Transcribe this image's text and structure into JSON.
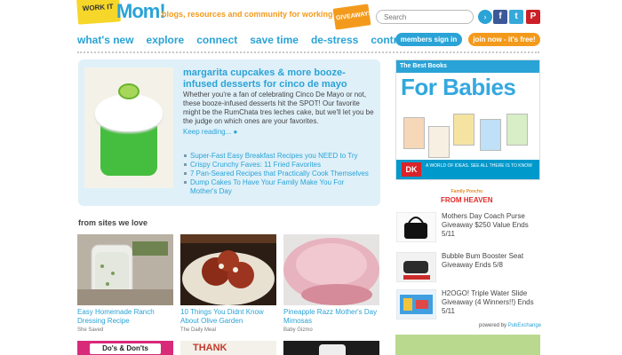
{
  "header": {
    "logo_note": "WORK IT",
    "logo_word": "Mom!",
    "tagline": "blogs, resources and community for working moms",
    "giveaways": "GIVEAWAYS",
    "search_placeholder": "Search",
    "go_icon": "arrow-right",
    "social": [
      "facebook",
      "twitter",
      "pinterest"
    ]
  },
  "nav": {
    "items": [
      "what's new",
      "explore",
      "connect",
      "save time",
      "de-stress",
      "contribute"
    ],
    "members_label": "members sign in",
    "join_label": "join now - it's free!"
  },
  "feature": {
    "title": "margarita cupcakes & more booze-infused desserts for cinco de mayo",
    "description": "Whether you're a fan of celebrating Cinco De Mayo or not, these booze-infused desserts hit the SPOT! Our favorite might be the RumChata tres leches cake, but we'll let you be the judge on which ones are your favorites.",
    "keep_reading": "Keep reading... ●",
    "related": [
      "Super-Fast Easy Breakfast Recipes you NEED to Try",
      "Crispy Crunchy Faves: 11 Fried Favorites",
      "7 Pan-Seared Recipes that Practically Cook Themselves",
      "Dump Cakes To Have Your Family Make You For Mother's Day"
    ]
  },
  "sites": {
    "heading": "from sites we love",
    "cards": [
      {
        "title": "Easy Homemade Ranch Dressing Recipe",
        "source": "She Saved"
      },
      {
        "title": "10 Things You Didnt Know About Olive Garden",
        "source": "The Daily Meal"
      },
      {
        "title": "Pineapple Razz Mother's Day Mimosas",
        "source": "Baby Gizmo"
      }
    ],
    "bottom_captions": [
      "Do's & Don'ts",
      "THANK",
      ""
    ]
  },
  "sidebar": {
    "ad_header": "The Best Books",
    "ad_title_for": "For",
    "ad_title_rest": "Babies",
    "ad_dk": "DK",
    "ad_world": "A WORLD OF IDEAS. SEE ALL THERE IS TO KNOW",
    "heaven_small": "Family Poncho",
    "heaven_big": "FROM HEAVEN",
    "items": [
      "Mothers Day Coach Purse Giveaway $250 Value Ends 5/11",
      "Bubble Bum Booster Seat Giveaway Ends 5/8",
      "H2OGO! Triple Water Slide Giveaway (4 Winners!!) Ends 5/11"
    ],
    "powered_prefix": "powered by",
    "powered_brand": "PubExchange"
  },
  "colors": {
    "blue": "#2aa3d6",
    "orange": "#f39a1c",
    "feature_bg": "#dff0f9"
  }
}
